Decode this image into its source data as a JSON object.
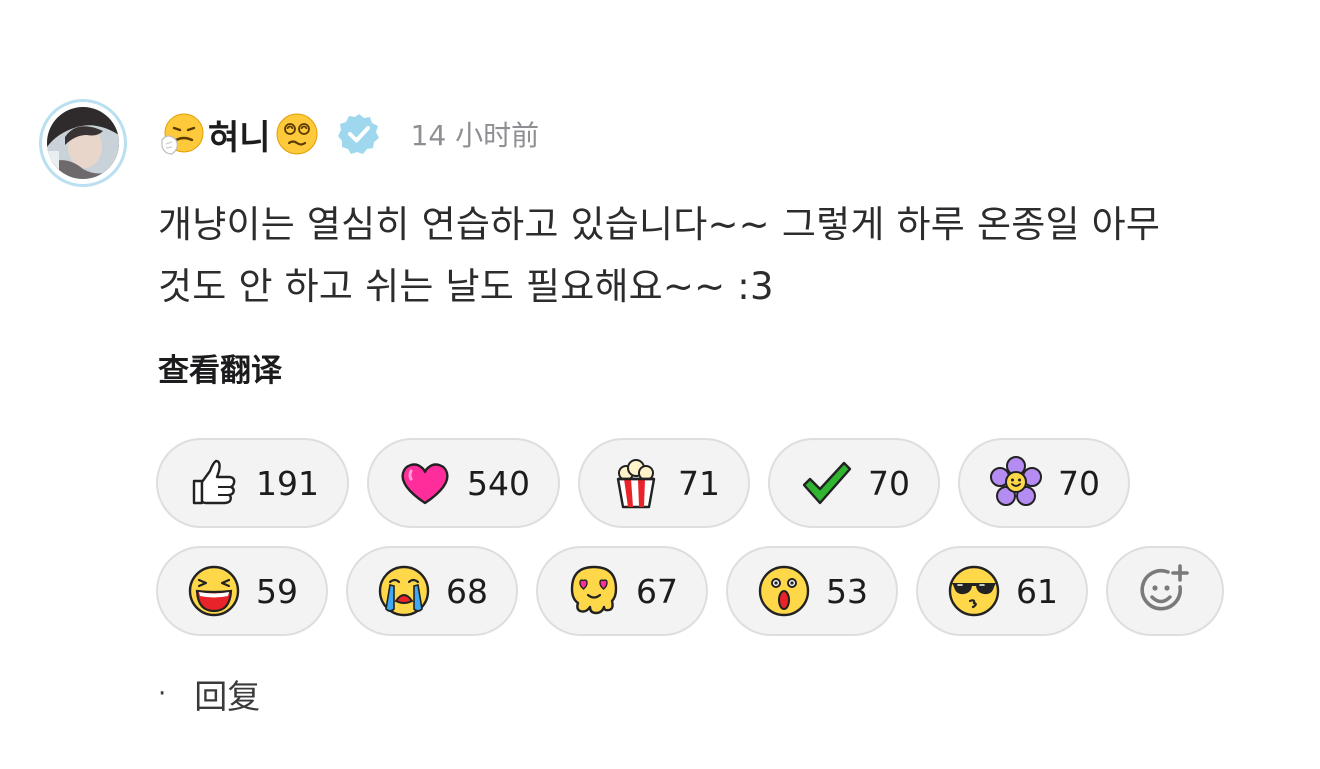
{
  "post": {
    "author": {
      "name": "혀니",
      "leading_emoji": "sneezing-face-icon",
      "trailing_emoji": "dizzy-face-icon",
      "verified_icon": "verified-badge-icon",
      "verified_color": "#9fd8ee"
    },
    "timestamp": "14 小时前",
    "content_line_1": "개냥이는 열심히 연습하고 있습니다~~ 그렇게 하루 온종일 아무",
    "content_line_2": "것도 안 하고 쉬는 날도 필요해요~~ :3",
    "translate_label": "查看翻译",
    "reply_label": "回复",
    "reply_separator": "·"
  },
  "reactions": {
    "row1": [
      {
        "icon": "thumbs-up-icon",
        "count": "191"
      },
      {
        "icon": "heart-icon",
        "count": "540"
      },
      {
        "icon": "popcorn-icon",
        "count": "71"
      },
      {
        "icon": "check-mark-icon",
        "count": "70"
      },
      {
        "icon": "flower-icon",
        "count": "70"
      }
    ],
    "row2": [
      {
        "icon": "laughing-face-icon",
        "count": "59"
      },
      {
        "icon": "crying-face-icon",
        "count": "68"
      },
      {
        "icon": "melting-heart-eyes-icon",
        "count": "67"
      },
      {
        "icon": "surprised-face-icon",
        "count": "53"
      },
      {
        "icon": "cool-sunglasses-face-icon",
        "count": "61"
      }
    ],
    "add_icon": "add-reaction-icon"
  },
  "colors": {
    "pill_background": "#f3f3f3",
    "pill_border": "#dedede",
    "timestamp": "#8e8e93",
    "heart": "#ff2d9b",
    "check": "#2fb52f",
    "flower": "#b58cf2",
    "face_yellow": "#ffd84a"
  }
}
